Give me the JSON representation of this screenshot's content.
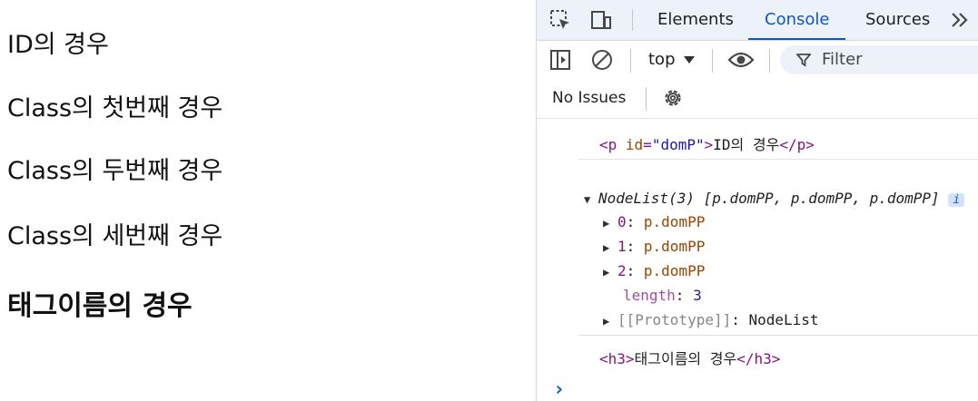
{
  "page": {
    "p1": "ID의 경우",
    "p2": "Class의 첫번째 경우",
    "p3": "Class의 두번째 경우",
    "p4": "Class의 세번째 경우",
    "h3": "태그이름의 경우"
  },
  "devtools": {
    "tabs": [
      "Elements",
      "Console",
      "Sources"
    ],
    "active_tab": "Console",
    "toolbar": {
      "context": "top",
      "filter_placeholder": "Filter"
    },
    "issues": "No Issues",
    "colors": {
      "accent": "#0b57d0",
      "tag": "#881280",
      "attr": "#994500",
      "attr_value": "#1a1aa6"
    },
    "console": {
      "entry1": {
        "open": "<p",
        "attr": "id",
        "eq": "=",
        "value": "\"domP\"",
        "close_open": ">",
        "text": "ID의 경우",
        "end": "</p>"
      },
      "entry2": {
        "summary": "NodeList(3) [p.domPP, p.domPP, p.domPP]",
        "info": "i",
        "items": [
          {
            "k": "0",
            "v": "p.domPP"
          },
          {
            "k": "1",
            "v": "p.domPP"
          },
          {
            "k": "2",
            "v": "p.domPP"
          }
        ],
        "length_key": "length",
        "length_val": "3",
        "proto_key": "[[Prototype]]",
        "proto_val": "NodeList"
      },
      "entry3": {
        "open": "<h3>",
        "text": "태그이름의 경우",
        "end": "</h3>"
      },
      "prompt": "›"
    }
  }
}
